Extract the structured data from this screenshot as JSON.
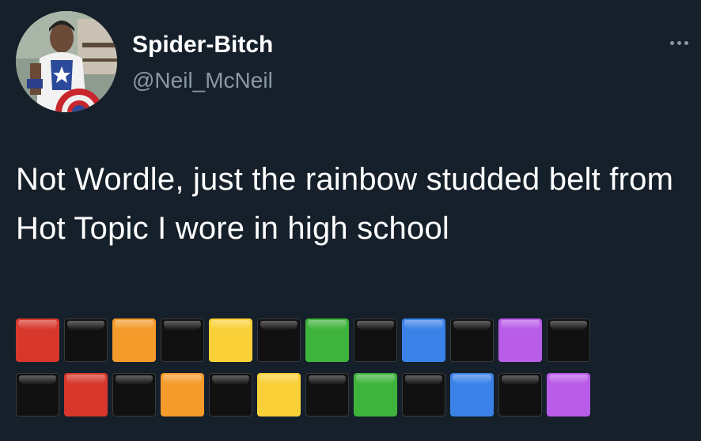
{
  "tweet": {
    "display_name": "Spider-Bitch",
    "handle": "@Neil_McNeil",
    "text": "Not Wordle, just the rainbow studded belt from Hot Topic I wore in high school",
    "more_icon": "more-horizontal-icon"
  },
  "emoji_rows": [
    [
      "red",
      "black",
      "orange",
      "black",
      "yellow",
      "black",
      "green",
      "black",
      "blue",
      "black",
      "purple",
      "black"
    ],
    [
      "black",
      "red",
      "black",
      "orange",
      "black",
      "yellow",
      "black",
      "green",
      "black",
      "blue",
      "black",
      "purple"
    ]
  ],
  "colors": {
    "background": "#15202b",
    "text": "#ffffff",
    "secondary_text": "#8b98a5",
    "red": "#d8382c",
    "orange": "#f49b2b",
    "yellow": "#f9d038",
    "green": "#3fb43c",
    "blue": "#3b82e8",
    "purple": "#b95ce8",
    "black": "#111111"
  }
}
